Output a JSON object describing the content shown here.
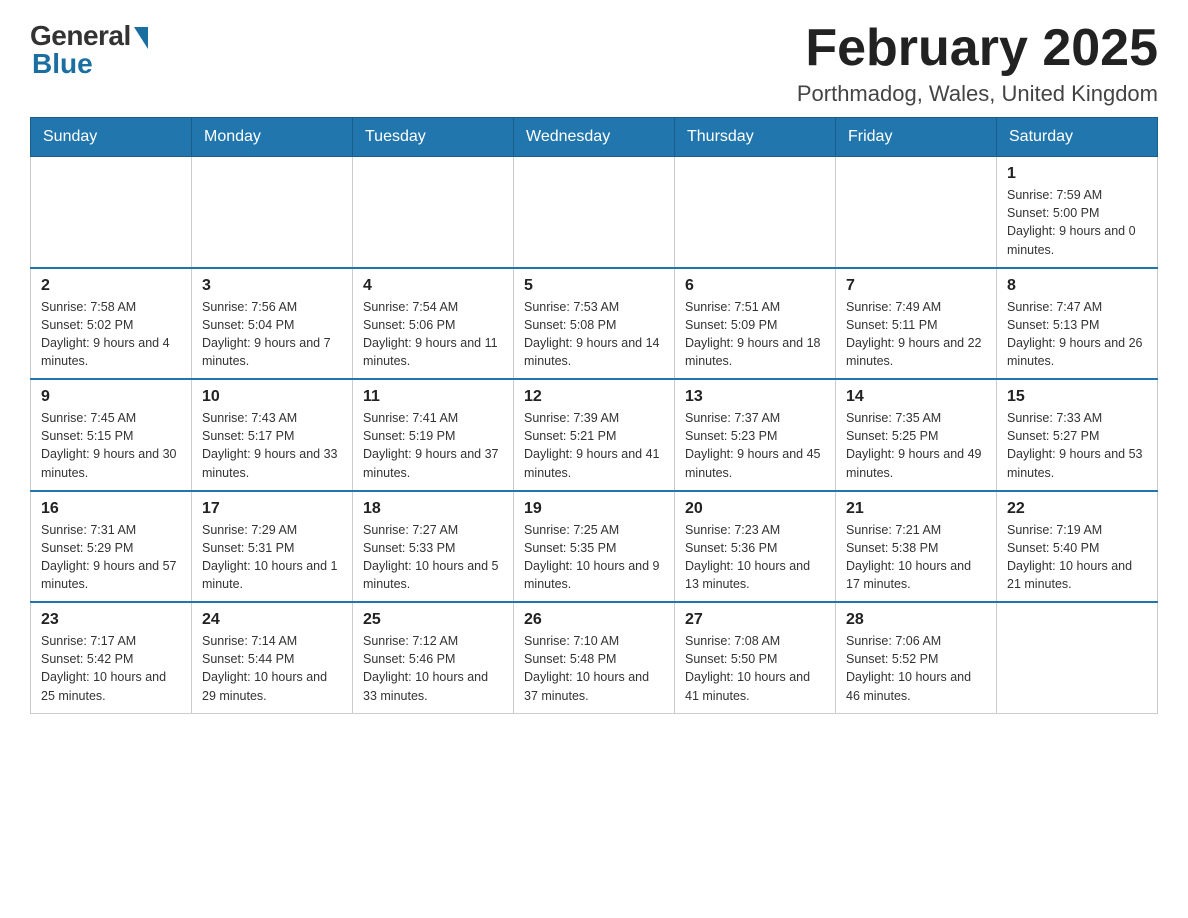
{
  "header": {
    "logo_general": "General",
    "logo_blue": "Blue",
    "month_year": "February 2025",
    "location": "Porthmadog, Wales, United Kingdom"
  },
  "days_of_week": [
    "Sunday",
    "Monday",
    "Tuesday",
    "Wednesday",
    "Thursday",
    "Friday",
    "Saturday"
  ],
  "weeks": [
    {
      "days": [
        {
          "number": "",
          "info": ""
        },
        {
          "number": "",
          "info": ""
        },
        {
          "number": "",
          "info": ""
        },
        {
          "number": "",
          "info": ""
        },
        {
          "number": "",
          "info": ""
        },
        {
          "number": "",
          "info": ""
        },
        {
          "number": "1",
          "info": "Sunrise: 7:59 AM\nSunset: 5:00 PM\nDaylight: 9 hours and 0 minutes."
        }
      ]
    },
    {
      "days": [
        {
          "number": "2",
          "info": "Sunrise: 7:58 AM\nSunset: 5:02 PM\nDaylight: 9 hours and 4 minutes."
        },
        {
          "number": "3",
          "info": "Sunrise: 7:56 AM\nSunset: 5:04 PM\nDaylight: 9 hours and 7 minutes."
        },
        {
          "number": "4",
          "info": "Sunrise: 7:54 AM\nSunset: 5:06 PM\nDaylight: 9 hours and 11 minutes."
        },
        {
          "number": "5",
          "info": "Sunrise: 7:53 AM\nSunset: 5:08 PM\nDaylight: 9 hours and 14 minutes."
        },
        {
          "number": "6",
          "info": "Sunrise: 7:51 AM\nSunset: 5:09 PM\nDaylight: 9 hours and 18 minutes."
        },
        {
          "number": "7",
          "info": "Sunrise: 7:49 AM\nSunset: 5:11 PM\nDaylight: 9 hours and 22 minutes."
        },
        {
          "number": "8",
          "info": "Sunrise: 7:47 AM\nSunset: 5:13 PM\nDaylight: 9 hours and 26 minutes."
        }
      ]
    },
    {
      "days": [
        {
          "number": "9",
          "info": "Sunrise: 7:45 AM\nSunset: 5:15 PM\nDaylight: 9 hours and 30 minutes."
        },
        {
          "number": "10",
          "info": "Sunrise: 7:43 AM\nSunset: 5:17 PM\nDaylight: 9 hours and 33 minutes."
        },
        {
          "number": "11",
          "info": "Sunrise: 7:41 AM\nSunset: 5:19 PM\nDaylight: 9 hours and 37 minutes."
        },
        {
          "number": "12",
          "info": "Sunrise: 7:39 AM\nSunset: 5:21 PM\nDaylight: 9 hours and 41 minutes."
        },
        {
          "number": "13",
          "info": "Sunrise: 7:37 AM\nSunset: 5:23 PM\nDaylight: 9 hours and 45 minutes."
        },
        {
          "number": "14",
          "info": "Sunrise: 7:35 AM\nSunset: 5:25 PM\nDaylight: 9 hours and 49 minutes."
        },
        {
          "number": "15",
          "info": "Sunrise: 7:33 AM\nSunset: 5:27 PM\nDaylight: 9 hours and 53 minutes."
        }
      ]
    },
    {
      "days": [
        {
          "number": "16",
          "info": "Sunrise: 7:31 AM\nSunset: 5:29 PM\nDaylight: 9 hours and 57 minutes."
        },
        {
          "number": "17",
          "info": "Sunrise: 7:29 AM\nSunset: 5:31 PM\nDaylight: 10 hours and 1 minute."
        },
        {
          "number": "18",
          "info": "Sunrise: 7:27 AM\nSunset: 5:33 PM\nDaylight: 10 hours and 5 minutes."
        },
        {
          "number": "19",
          "info": "Sunrise: 7:25 AM\nSunset: 5:35 PM\nDaylight: 10 hours and 9 minutes."
        },
        {
          "number": "20",
          "info": "Sunrise: 7:23 AM\nSunset: 5:36 PM\nDaylight: 10 hours and 13 minutes."
        },
        {
          "number": "21",
          "info": "Sunrise: 7:21 AM\nSunset: 5:38 PM\nDaylight: 10 hours and 17 minutes."
        },
        {
          "number": "22",
          "info": "Sunrise: 7:19 AM\nSunset: 5:40 PM\nDaylight: 10 hours and 21 minutes."
        }
      ]
    },
    {
      "days": [
        {
          "number": "23",
          "info": "Sunrise: 7:17 AM\nSunset: 5:42 PM\nDaylight: 10 hours and 25 minutes."
        },
        {
          "number": "24",
          "info": "Sunrise: 7:14 AM\nSunset: 5:44 PM\nDaylight: 10 hours and 29 minutes."
        },
        {
          "number": "25",
          "info": "Sunrise: 7:12 AM\nSunset: 5:46 PM\nDaylight: 10 hours and 33 minutes."
        },
        {
          "number": "26",
          "info": "Sunrise: 7:10 AM\nSunset: 5:48 PM\nDaylight: 10 hours and 37 minutes."
        },
        {
          "number": "27",
          "info": "Sunrise: 7:08 AM\nSunset: 5:50 PM\nDaylight: 10 hours and 41 minutes."
        },
        {
          "number": "28",
          "info": "Sunrise: 7:06 AM\nSunset: 5:52 PM\nDaylight: 10 hours and 46 minutes."
        },
        {
          "number": "",
          "info": ""
        }
      ]
    }
  ]
}
